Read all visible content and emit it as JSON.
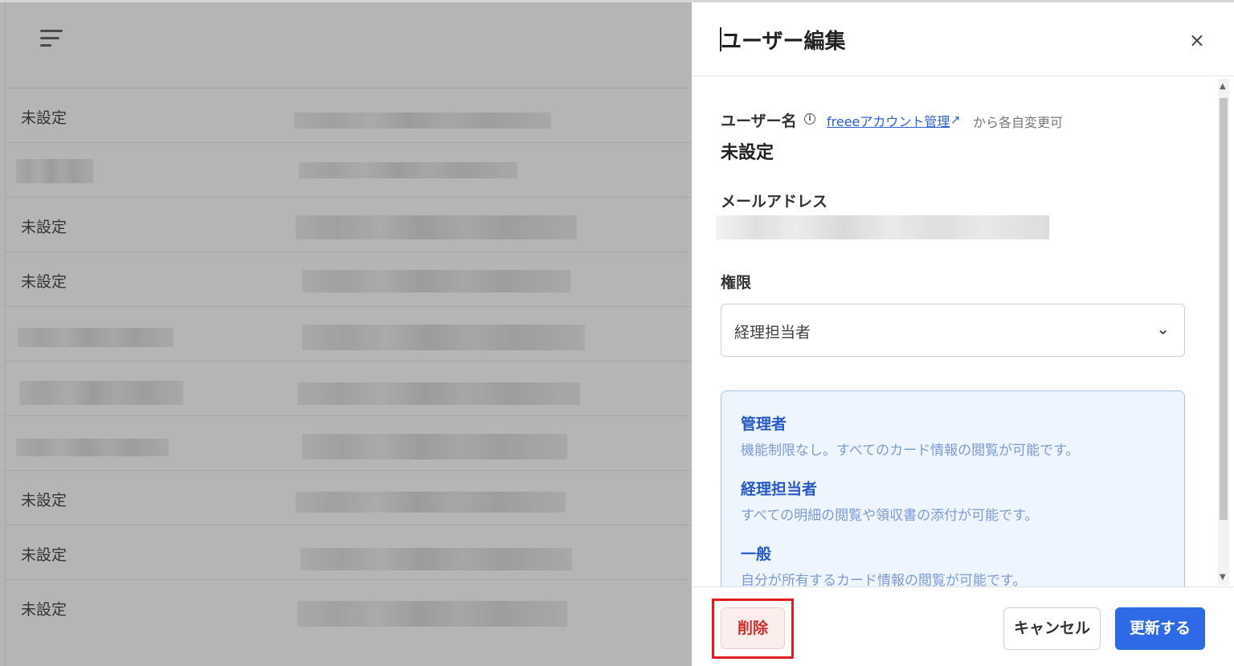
{
  "background_list": {
    "rows": [
      {
        "name": "未設定"
      },
      {
        "name": ""
      },
      {
        "name": "未設定"
      },
      {
        "name": "未設定"
      },
      {
        "name": ""
      },
      {
        "name": ""
      },
      {
        "name": ""
      },
      {
        "name": "未設定"
      },
      {
        "name": "未設定"
      },
      {
        "name": "未設定"
      }
    ]
  },
  "panel": {
    "title": "ユーザー編集",
    "close_icon": "×",
    "username": {
      "label": "ユーザー名",
      "info_icon": "i",
      "link_text": "freeeアカウント管理",
      "external_icon": "↗",
      "hint": "から各自変更可",
      "value": "未設定"
    },
    "email": {
      "label": "メールアドレス"
    },
    "role": {
      "label": "権限",
      "selected": "経理担当者",
      "chevron": "⌄"
    },
    "role_descriptions": [
      {
        "title": "管理者",
        "desc": "機能制限なし。すべてのカード情報の閲覧が可能です。"
      },
      {
        "title": "経理担当者",
        "desc": "すべての明細の閲覧や領収書の添付が可能です。"
      },
      {
        "title": "一般",
        "desc": "自分が所有するカード情報の閲覧が可能です。"
      }
    ],
    "footer": {
      "delete_label": "削除",
      "cancel_label": "キャンセル",
      "update_label": "更新する"
    }
  },
  "colors": {
    "primary": "#2e6ae6",
    "danger": "#d62b2b",
    "highlight_box": "#e01e1e",
    "info_bg": "#eef5fe"
  }
}
